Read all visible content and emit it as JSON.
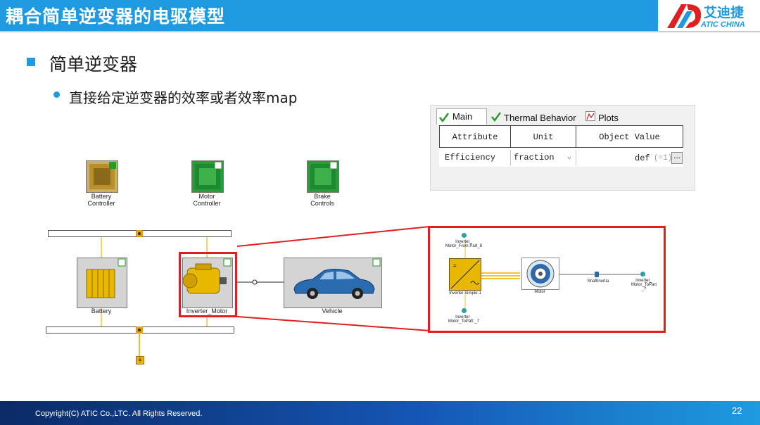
{
  "header": {
    "title": "耦合简单逆变器的电驱模型",
    "logo_cn": "艾迪捷",
    "logo_en": "ATIC CHINA"
  },
  "content": {
    "heading": "简单逆变器",
    "bullet": "直接给定逆变器的效率或者效率map"
  },
  "panel": {
    "tabs": [
      {
        "label": "Main",
        "icon": "check-icon",
        "active": true
      },
      {
        "label": "Thermal Behavior",
        "icon": "check-icon",
        "active": false
      },
      {
        "label": "Plots",
        "icon": "plot-icon",
        "active": false
      }
    ],
    "columns": [
      "Attribute",
      "Unit",
      "Object Value"
    ],
    "row": {
      "attribute": "Efficiency",
      "unit": "fraction",
      "value": "def",
      "value_hint": "(=1)",
      "browse": "..."
    }
  },
  "diagram": {
    "controllers": [
      {
        "line1": "Battery",
        "line2": "Controller"
      },
      {
        "line1": "Motor",
        "line2": "Controller"
      },
      {
        "line1": "Brake",
        "line2": "Controls"
      }
    ],
    "components": {
      "battery": "Battery",
      "motor": "Inverter_Motor",
      "vehicle": "Vehicle"
    },
    "detail": {
      "in_top": "Inverter_ Motor_From Part_8",
      "inverter": "Inverter Simple-1",
      "in_bottom": "Inverter_ Motor_ToPart _7",
      "motor": "Motor",
      "shaft": "ShaftInertia",
      "out": "Inverter_ Motor_ToPart _?"
    }
  },
  "footer": {
    "copyright": "Copyright(C) ATIC Co.,LTC. All Rights Reserved.",
    "page": "22"
  },
  "colors": {
    "accent": "#1e9be0",
    "highlight": "#e02020",
    "component": "#e8b800"
  }
}
